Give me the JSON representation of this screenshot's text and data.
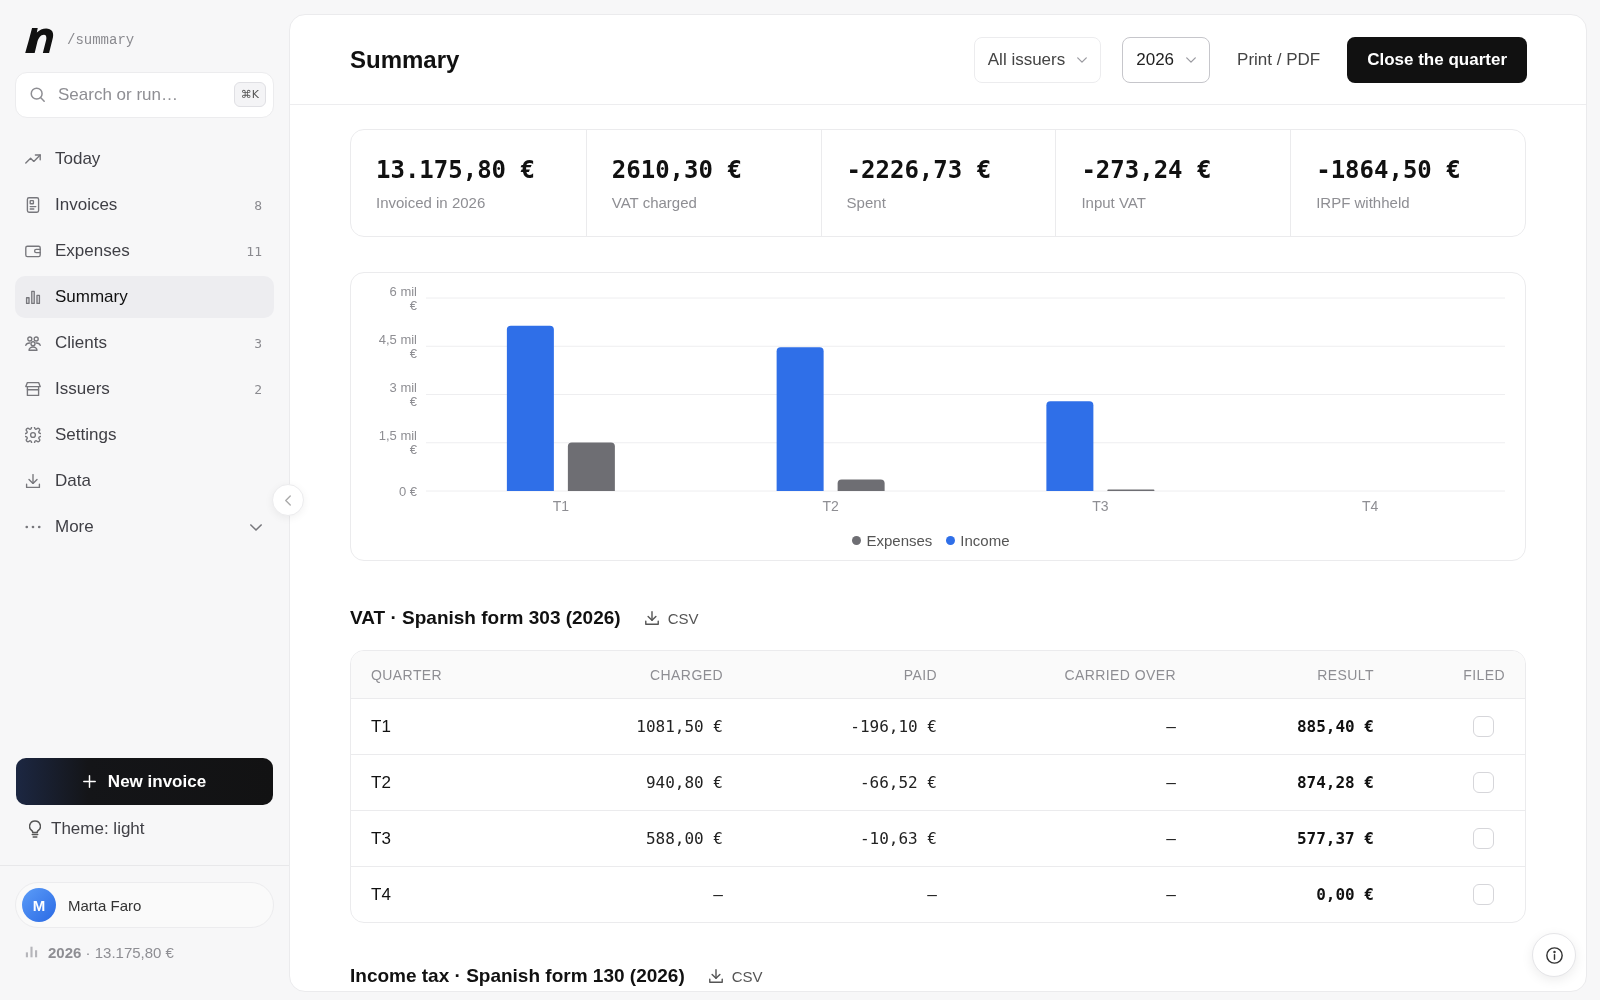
{
  "sidebar": {
    "path": "/summary",
    "search": {
      "placeholder": "Search or run…",
      "shortcut": "⌘K"
    },
    "nav": [
      {
        "label": "Today",
        "selected": false
      },
      {
        "label": "Invoices",
        "count": "8",
        "selected": false
      },
      {
        "label": "Expenses",
        "count": "11",
        "selected": false
      },
      {
        "label": "Summary",
        "selected": true
      },
      {
        "label": "Clients",
        "count": "3",
        "selected": false
      },
      {
        "label": "Issuers",
        "count": "2",
        "selected": false
      },
      {
        "label": "Settings",
        "selected": false
      },
      {
        "label": "Data",
        "selected": false
      }
    ],
    "more": {
      "label": "More",
      "expanded": false
    },
    "new_invoice_button": "New invoice",
    "theme_toggle": "Theme: light",
    "user": {
      "initial": "M",
      "name": "Marta Faro"
    },
    "year_total": "**2026** · 13.175,80 €"
  },
  "header": {
    "title": "Summary",
    "filters": [
      {
        "label": "All issuers",
        "active": false
      },
      {
        "label": "2026",
        "active": true
      }
    ],
    "print_button": "Print / PDF",
    "primary_button": "Close the quarter"
  },
  "stats": [
    {
      "value": "13.175,80 €",
      "label": "Invoiced in 2026"
    },
    {
      "value": "2610,30 €",
      "label": "VAT charged"
    },
    {
      "value": "-2226,73 €",
      "label": "Spent"
    },
    {
      "value": "-273,24 €",
      "label": "Input VAT"
    },
    {
      "value": "-1864,50 €",
      "label": "IRPF withheld"
    }
  ],
  "chart": {
    "chart_data": {
      "type": "bar",
      "categories": [
        "T1",
        "T2",
        "T3",
        "T4"
      ],
      "series": [
        {
          "name": "Income",
          "color": "#2f6fe8",
          "values": [
            5.14,
            4.47,
            2.79,
            0
          ]
        },
        {
          "name": "Expenses",
          "color": "#6e6e73",
          "values": [
            1.51,
            0.36,
            0.05,
            0
          ]
        }
      ],
      "ylim": [
        0,
        6
      ],
      "yticks": [
        {
          "value": 0,
          "label": "0 €"
        },
        {
          "value": 1.5,
          "label": "1,5 mil €"
        },
        {
          "value": 3,
          "label": "3 mil €"
        },
        {
          "value": 4.5,
          "label": "4,5 mil €"
        },
        {
          "value": 6,
          "label": "6 mil €"
        }
      ],
      "grid": true,
      "legend": true
    }
  },
  "vat_section": {
    "title": "VAT · Spanish form 303 (2026)",
    "export_button": "CSV",
    "table": {
      "columns": [
        "QUARTER",
        "CHARGED",
        "PAID",
        "CARRIED OVER",
        "RESULT",
        "FILED"
      ],
      "rows": [
        {
          "cells": [
            "T1",
            "1081,50 €",
            "-196,10 €",
            "–",
            "885,40 €"
          ],
          "filed": false
        },
        {
          "cells": [
            "T2",
            "940,80 €",
            "-66,52 €",
            "–",
            "874,28 €"
          ],
          "filed": false
        },
        {
          "cells": [
            "T3",
            "588,00 €",
            "-10,63 €",
            "–",
            "577,37 €"
          ],
          "filed": false
        },
        {
          "cells": [
            "T4",
            "–",
            "–",
            "–",
            "0,00 €"
          ],
          "filed": false
        }
      ]
    }
  },
  "income_tax_section": {
    "title": "Income tax · Spanish form 130 (2026)",
    "export_button": "CSV"
  }
}
